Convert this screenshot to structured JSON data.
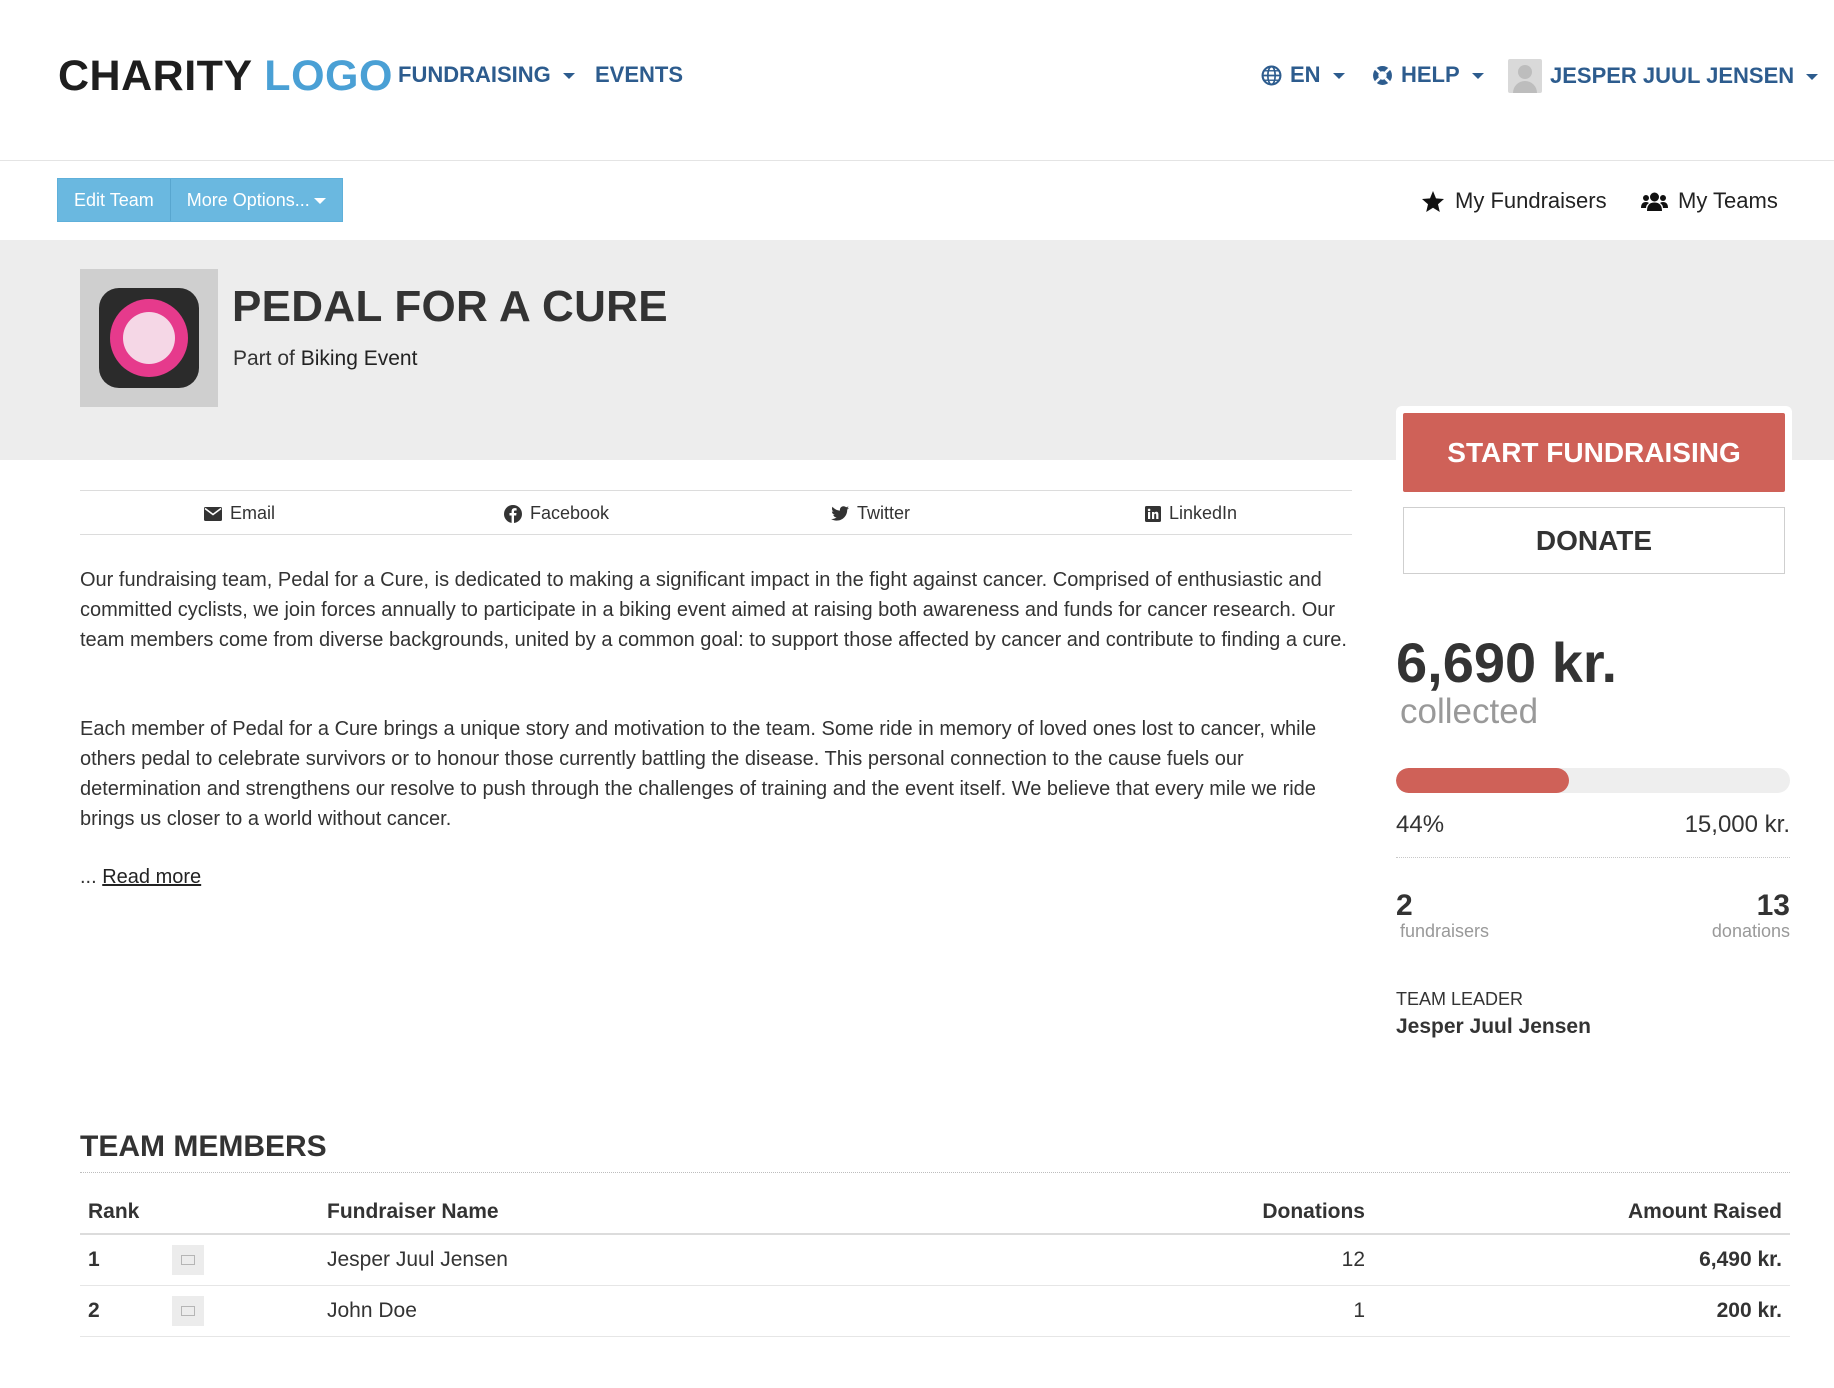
{
  "nav": {
    "logo_dark": "CHARITY",
    "logo_light": "LOGO",
    "fundraising": "FUNDRAISING",
    "events": "EVENTS",
    "language": "EN",
    "help": "HELP",
    "user": "JESPER JUUL JENSEN"
  },
  "toolbar": {
    "edit_team": "Edit Team",
    "more_options": "More Options...",
    "my_fundraisers": "My Fundraisers",
    "my_teams": "My Teams"
  },
  "team": {
    "title": "PEDAL FOR A CURE",
    "part_of_prefix": "Part of",
    "event_name": "Biking Event"
  },
  "share": {
    "email": "Email",
    "facebook": "Facebook",
    "twitter": "Twitter",
    "linkedin": "LinkedIn"
  },
  "description": {
    "paragraph1": "Our fundraising team, Pedal for a Cure, is dedicated to making a significant impact in the fight against cancer. Comprised of enthusiastic and committed cyclists, we join forces annually to participate in a biking event aimed at raising both awareness and funds for cancer research. Our team members come from diverse backgrounds, united by a common goal: to support those affected by cancer and contribute to finding a cure.",
    "paragraph2": "Each member of Pedal for a Cure brings a unique story and motivation to the team. Some ride in memory of loved ones lost to cancer, while others pedal to celebrate survivors or to honour those currently battling the disease. This personal connection to the cause fuels our determination and strengthens our resolve to push through the challenges of training and the event itself. We believe that every mile we ride brings us closer to a world without cancer.",
    "ellipsis": "...",
    "read_more": "Read more"
  },
  "sidebar": {
    "start_fundraising": "START FUNDRAISING",
    "donate": "DONATE",
    "collected_amount": "6,690 kr.",
    "collected_label": "collected",
    "progress_percent": "44%",
    "progress_fraction": 0.44,
    "goal": "15,000 kr.",
    "fundraisers_count": "2",
    "fundraisers_label": "fundraisers",
    "donations_count": "13",
    "donations_label": "donations",
    "team_leader_label": "TEAM LEADER",
    "team_leader_name": "Jesper Juul Jensen"
  },
  "members": {
    "title": "TEAM MEMBERS",
    "headers": {
      "rank": "Rank",
      "name": "Fundraiser Name",
      "donations": "Donations",
      "amount": "Amount Raised"
    },
    "rows": [
      {
        "rank": "1",
        "name": "Jesper Juul Jensen",
        "donations": "12",
        "amount": "6,490 kr."
      },
      {
        "rank": "2",
        "name": "John Doe",
        "donations": "1",
        "amount": "200 kr."
      }
    ]
  },
  "colors": {
    "brand_blue": "#4aa0d5",
    "nav_blue": "#2d5c8e",
    "accent_red": "#cf6158",
    "button_blue": "#6ab8e0"
  },
  "icons": {
    "language": "globe-icon",
    "help": "lifebuoy-icon",
    "my_fundraisers": "star-icon",
    "my_teams": "users-icon",
    "email": "envelope-icon",
    "facebook": "facebook-icon",
    "twitter": "twitter-icon",
    "linkedin": "linkedin-icon"
  }
}
